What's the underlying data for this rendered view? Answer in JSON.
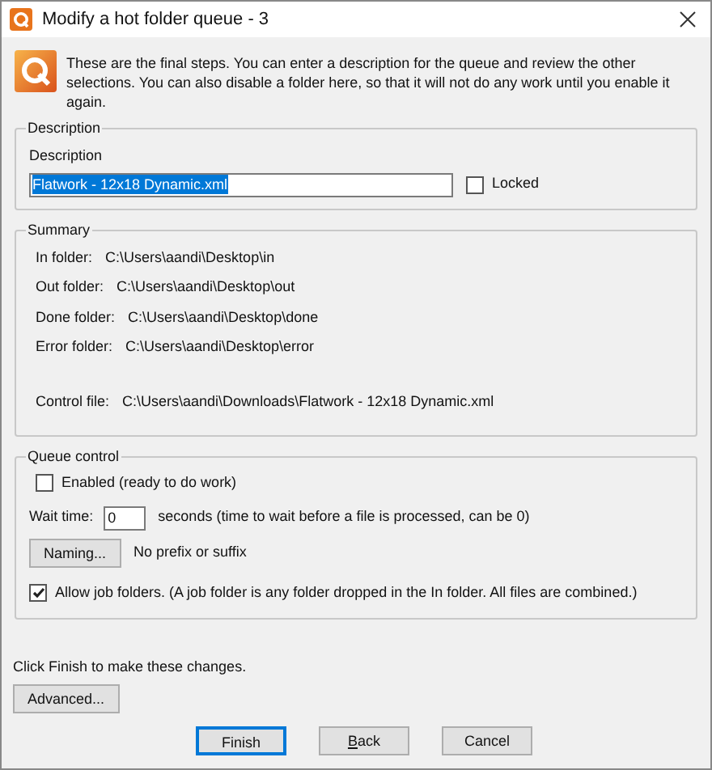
{
  "window": {
    "title": "Modify a hot folder queue - 3"
  },
  "intro": "These are the final steps. You can enter a description for the queue and review the other selections. You can also disable a folder here, so that it will not do any work until you enable it again.",
  "description_group": {
    "legend": "Description",
    "label": "Description",
    "value": "Flatwork - 12x18 Dynamic.xml",
    "value_selected": true,
    "locked": {
      "label": "Locked",
      "checked": false
    }
  },
  "summary": {
    "legend": "Summary",
    "rows": [
      {
        "label": "In folder:",
        "value": "C:\\Users\\aandi\\Desktop\\in"
      },
      {
        "label": "Out folder:",
        "value": "C:\\Users\\aandi\\Desktop\\out"
      },
      {
        "label": "Done folder:",
        "value": "C:\\Users\\aandi\\Desktop\\done"
      },
      {
        "label": "Error folder:",
        "value": "C:\\Users\\aandi\\Desktop\\error"
      }
    ],
    "control_file": {
      "label": "Control file:",
      "value": "C:\\Users\\aandi\\Downloads\\Flatwork - 12x18 Dynamic.xml"
    }
  },
  "queue_control": {
    "legend": "Queue control",
    "enabled": {
      "label": "Enabled (ready to do work)",
      "checked": false
    },
    "wait_time": {
      "label": "Wait time:",
      "value": "0",
      "hint": "seconds (time to wait before a file is processed, can be 0)"
    },
    "naming": {
      "button": "Naming...",
      "text": "No prefix or suffix"
    },
    "job_folders": {
      "label": "Allow job folders. (A job folder is any folder dropped in the In folder. All files are combined.)",
      "checked": true
    }
  },
  "footer_text": "Click Finish to make these changes.",
  "advanced_button": "Advanced...",
  "buttons": [
    {
      "label": "Finish",
      "default": true,
      "mnemonic": false
    },
    {
      "label": "Back",
      "default": false,
      "mnemonic": true
    },
    {
      "label": "Cancel",
      "default": false,
      "mnemonic": false
    }
  ]
}
